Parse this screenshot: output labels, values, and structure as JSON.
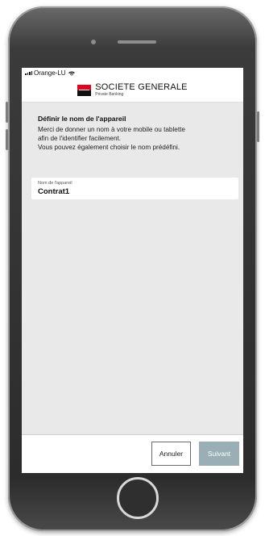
{
  "status_bar": {
    "carrier": "Orange-LU",
    "wifi_icon": "wifi-icon",
    "signal_icon": "signal-icon"
  },
  "brand": {
    "name": "SOCIETE GENERALE",
    "subtitle": "Private Banking",
    "colors": {
      "red": "#e2001a",
      "black": "#111111"
    }
  },
  "page": {
    "title": "Définir le nom de l'appareil",
    "description": [
      "Merci de donner un nom à votre mobile ou tablette",
      "afin de l'identifier facilement.",
      "Vous pouvez également choisir le nom prédéfini."
    ]
  },
  "device_name_field": {
    "label": "Nom de l'appareil",
    "value": "Contrat1"
  },
  "footer": {
    "cancel_label": "Annuler",
    "next_label": "Suivant",
    "next_color": "#9aaeb5"
  }
}
